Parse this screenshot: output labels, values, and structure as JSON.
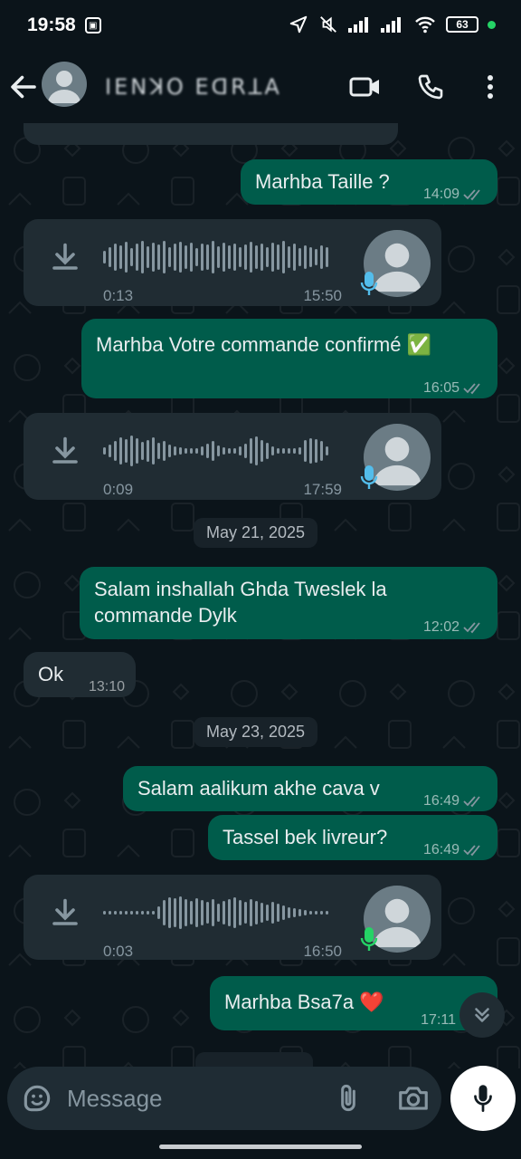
{
  "status_bar": {
    "time": "19:58",
    "battery": "63"
  },
  "header": {
    "contact_name": "ꓲꓰꓠꓘꓳ ꓰꓷꓣꓕꓮ",
    "icons": [
      "back-arrow-icon",
      "video-call-icon",
      "phone-call-icon",
      "more-vert-icon"
    ]
  },
  "messages": [
    {
      "type": "text",
      "direction": "out",
      "text": "Marhba Taille ?",
      "time": "14:09"
    },
    {
      "type": "voice",
      "direction": "in",
      "duration": "0:13",
      "time": "15:50",
      "mic_color": "#53bdeb"
    },
    {
      "type": "text",
      "direction": "out",
      "text": "Marhba Votre commande confirmé ✅",
      "time": "16:05"
    },
    {
      "type": "voice",
      "direction": "in",
      "duration": "0:09",
      "time": "17:59",
      "mic_color": "#53bdeb"
    },
    {
      "type": "date",
      "text": "May 21, 2025"
    },
    {
      "type": "text",
      "direction": "out",
      "text_line1": "Salam inshallah Ghda Tweslek la",
      "text_line2": "commande Dylk",
      "time": "12:02"
    },
    {
      "type": "text",
      "direction": "in",
      "text": "Ok",
      "time": "13:10"
    },
    {
      "type": "date",
      "text": "May 23, 2025"
    },
    {
      "type": "text",
      "direction": "out",
      "text": "Salam aalikum akhe cava v",
      "time": "16:49"
    },
    {
      "type": "text",
      "direction": "out",
      "text": "Tassel bek livreur?",
      "time": "16:49"
    },
    {
      "type": "voice",
      "direction": "in",
      "duration": "0:03",
      "time": "16:50",
      "mic_color": "#25d366"
    },
    {
      "type": "text",
      "direction": "out",
      "text": "Marhba Bsa7a ❤️",
      "time": "17:11"
    }
  ],
  "composer": {
    "placeholder": "Message",
    "icons": [
      "sticker-icon",
      "attach-icon",
      "camera-icon",
      "mic-icon"
    ]
  },
  "colors": {
    "outgoing": "#005c4b",
    "incoming": "#202c33",
    "background": "#0b141a",
    "read_tick": "#8696a0"
  }
}
